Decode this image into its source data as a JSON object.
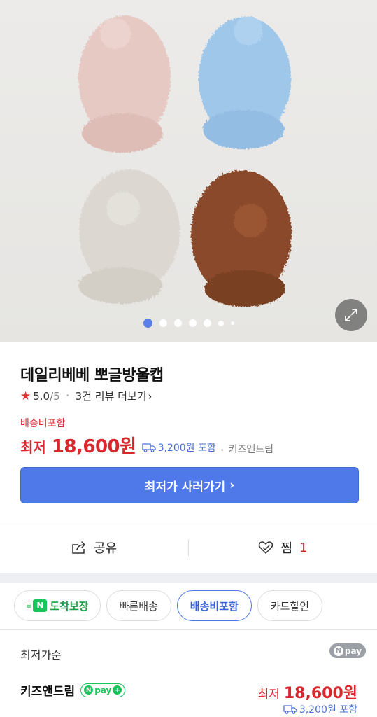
{
  "product": {
    "title": "데일리베베 뽀글방울캡",
    "rating": "5.0",
    "rating_max": "/5",
    "reviews_link": "3건 리뷰 더보기",
    "shipping_included": "배송비포함",
    "price_label": "최저",
    "price": "18,600원",
    "shipping_fee": "3,200원 포함",
    "seller": "키즈앤드림",
    "images_total": 7,
    "image_current": 1
  },
  "buy_button": {
    "label": "최저가 사러가기"
  },
  "actions": {
    "share_label": "공유",
    "zzim_label": "찜",
    "zzim_count": "1"
  },
  "filters": {
    "chips": [
      {
        "label": "도착보장",
        "active": false
      },
      {
        "label": "빠른배송",
        "active": false
      },
      {
        "label": "배송비포함",
        "active": true
      },
      {
        "label": "카드할인",
        "active": false
      }
    ]
  },
  "offers": {
    "sort_label": "최저가순",
    "npay_label": "pay",
    "items": [
      {
        "seller": "키즈앤드림",
        "price_label": "최저",
        "price": "18,600원",
        "shipping": "3,200원 포함"
      }
    ]
  },
  "colors": {
    "accent_blue": "#4f79e8",
    "price_red": "#d9272e",
    "npay_green": "#19c45a"
  }
}
